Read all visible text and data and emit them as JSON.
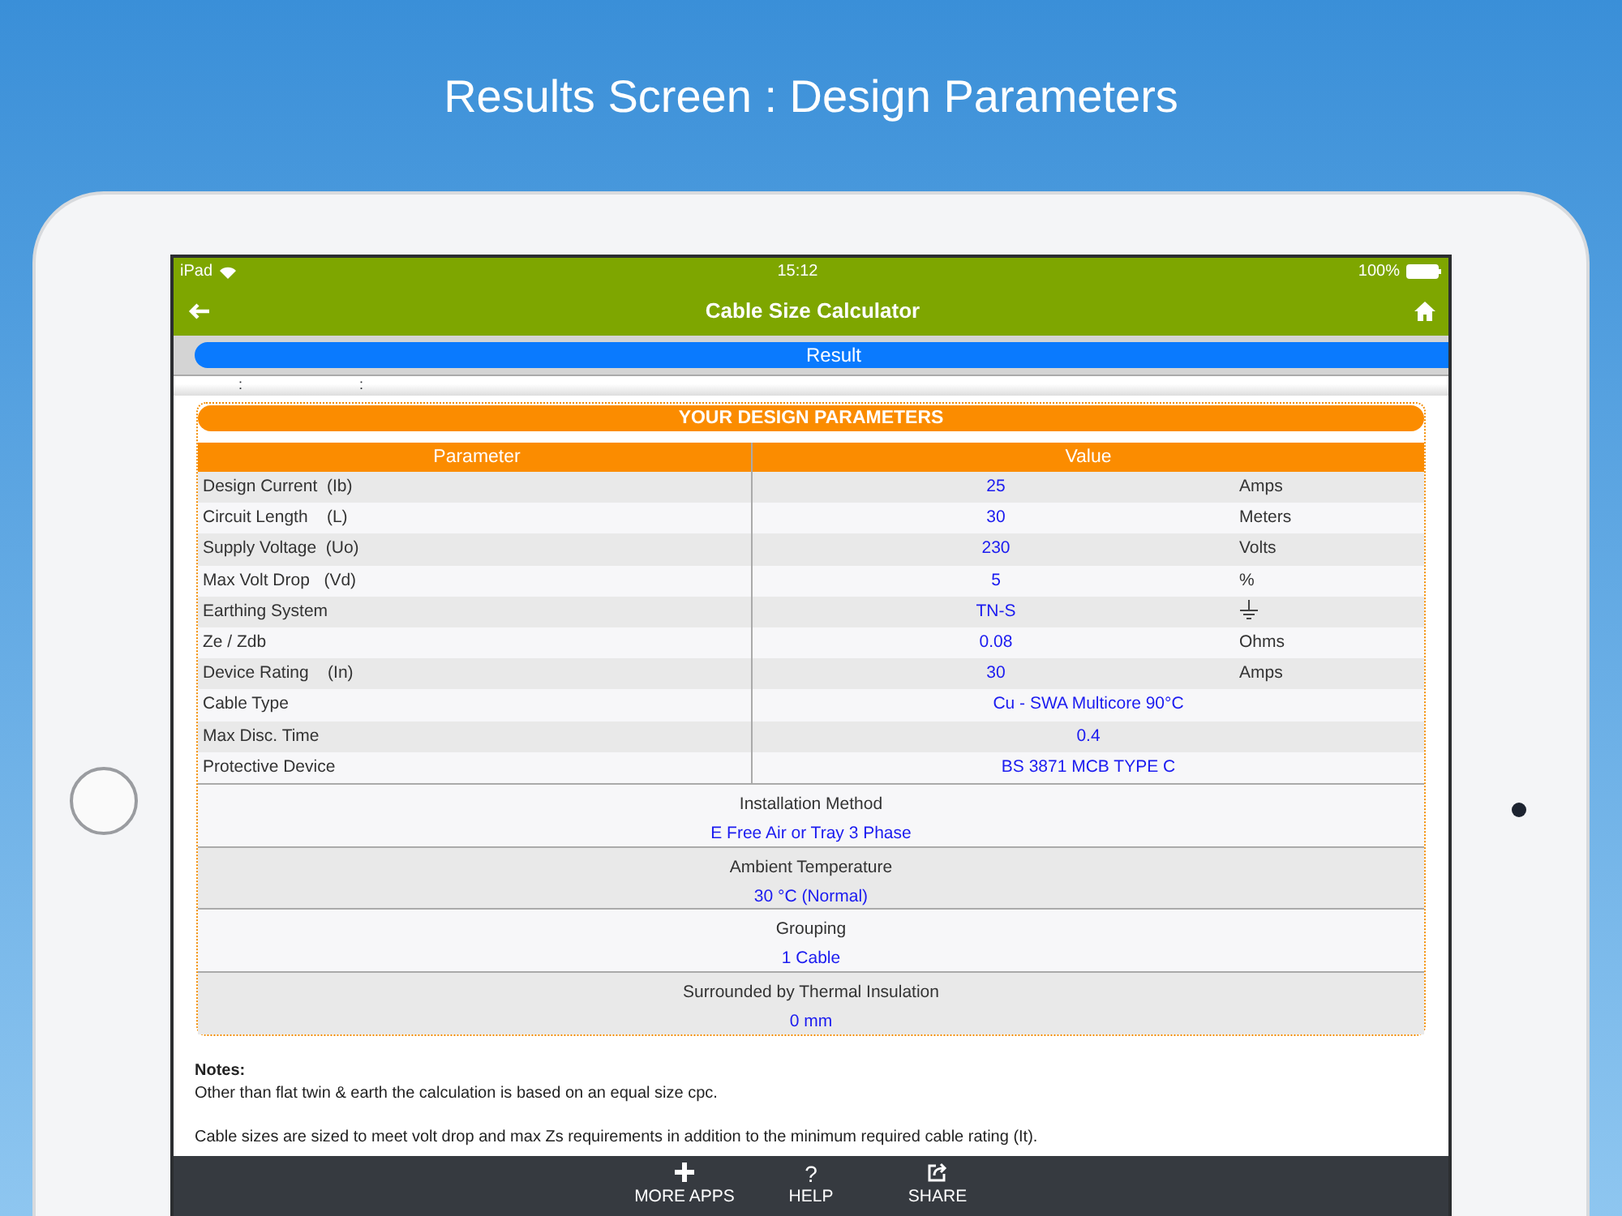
{
  "page_title": "Results Screen : Design Parameters",
  "status_bar": {
    "carrier": "iPad",
    "time": "15:12",
    "battery": "100%"
  },
  "nav_bar": {
    "title": "Cable Size Calculator"
  },
  "segment": {
    "label": "Result"
  },
  "markers": [
    ":",
    ":"
  ],
  "card": {
    "title": "YOUR DESIGN PARAMETERS",
    "columns": [
      "Parameter",
      "Value"
    ],
    "rows": [
      {
        "kind": "unit",
        "parameter": "Design Current  (Ib)",
        "value": "25",
        "unit": "Amps"
      },
      {
        "kind": "unit",
        "parameter": "Circuit Length    (L)",
        "value": "30",
        "unit": "Meters"
      },
      {
        "kind": "unit",
        "parameter": "Supply Voltage  (Uo)",
        "value": "230",
        "unit": "Volts"
      },
      {
        "kind": "unit",
        "parameter": "Max Volt Drop   (Vd)",
        "value": "5",
        "unit": "%"
      },
      {
        "kind": "earth",
        "parameter": "Earthing System",
        "value": "TN-S"
      },
      {
        "kind": "unit",
        "parameter": "Ze / Zdb",
        "value": "0.08",
        "unit": "Ohms"
      },
      {
        "kind": "unit",
        "parameter": "Device Rating    (In)",
        "value": "30",
        "unit": "Amps"
      },
      {
        "kind": "plain",
        "parameter": "Cable Type",
        "value": "Cu - SWA Multicore 90°C"
      },
      {
        "kind": "plain",
        "parameter": "Max Disc. Time",
        "value": "0.4"
      },
      {
        "kind": "plain",
        "parameter": "Protective Device",
        "value": "BS 3871 MCB TYPE C"
      }
    ],
    "sections": [
      {
        "label": "Installation Method",
        "value": "E Free Air or Tray 3 Phase"
      },
      {
        "label": "Ambient Temperature",
        "value": "30 °C (Normal)"
      },
      {
        "label": "Grouping",
        "value": "1 Cable"
      },
      {
        "label": "Surrounded by Thermal Insulation",
        "value": "0 mm"
      }
    ]
  },
  "notes": {
    "heading": "Notes:",
    "lines": [
      "Other than flat twin & earth the calculation is based on an equal size cpc.",
      "Cable sizes are sized to meet volt drop and max Zs requirements in addition to the minimum required cable rating (It)."
    ]
  },
  "tab_bar": [
    {
      "kind": "plus",
      "label": "MORE APPS"
    },
    {
      "kind": "question",
      "glyph": "?",
      "label": "HELP"
    },
    {
      "kind": "share",
      "label": "SHARE"
    }
  ]
}
